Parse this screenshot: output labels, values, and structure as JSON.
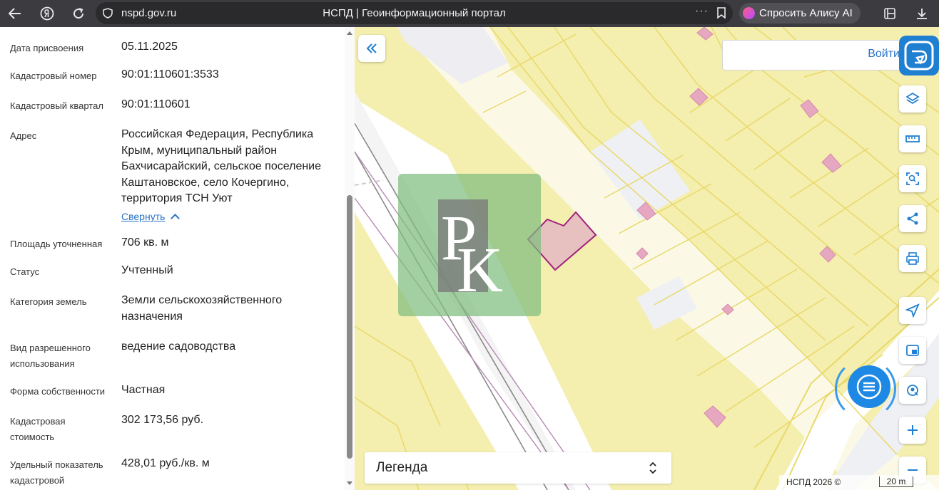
{
  "browser": {
    "url": "nspd.gov.ru",
    "title": "НСПД | Геоинформационный портал",
    "alice_label": "Спросить Алису AI",
    "more_label": "···"
  },
  "info": {
    "rows": [
      {
        "label": "Дата присвоения",
        "value": "05.11.2025"
      },
      {
        "label": "Кадастровый номер",
        "value": "90:01:110601:3533"
      },
      {
        "label": "Кадастровый квартал",
        "value": "90:01:110601"
      },
      {
        "label": "Адрес",
        "value": "Российская Федерация, Республика Крым, муниципальный район Бахчисарайский, сельское поселение Каштановское, село Кочергино, территория ТСН Уют"
      },
      {
        "label": "Площадь уточненная",
        "value": "706 кв. м"
      },
      {
        "label": "Статус",
        "value": "Учтенный"
      },
      {
        "label": "Категория земель",
        "value": "Земли сельскохозяйственного назначения"
      },
      {
        "label": "Вид разрешенного использования",
        "value": "ведение садоводства"
      },
      {
        "label": "Форма собственности",
        "value": "Частная"
      },
      {
        "label": "Кадастровая стоимость",
        "value": "302 173,56 руб."
      },
      {
        "label": "Удельный показатель кадастровой",
        "value": "428,01 руб./кв. м"
      }
    ],
    "collapse_label": "Свернуть"
  },
  "map": {
    "login_label": "Войти",
    "legend_label": "Легенда",
    "attribution": "НСПД 2026 ©",
    "scale_label": "20 m",
    "watermark_letters": "PK",
    "colors": {
      "parcel_fill": "#f4eeaf",
      "parcel_line": "#e9d96a",
      "road": "#ffffff",
      "selected": "#a0207e",
      "building": "#e6a8c0",
      "accent": "#1e88e5"
    }
  }
}
